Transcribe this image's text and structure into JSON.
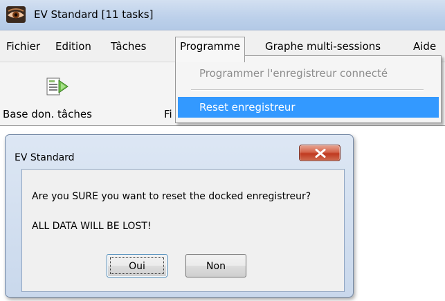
{
  "main_window": {
    "title": "EV Standard [11 tasks]",
    "icon": "eye-app-icon"
  },
  "menubar": {
    "items": [
      {
        "label": "Fichier"
      },
      {
        "label": "Edition"
      },
      {
        "label": "Tâches"
      },
      {
        "label": "Programme",
        "open": true
      },
      {
        "label": "Graphe multi-sessions"
      },
      {
        "label": "Aide"
      }
    ]
  },
  "toolbar": {
    "items": [
      {
        "label": "Base don. tâches",
        "icon": "task-database-icon"
      },
      {
        "label": "Fi"
      }
    ]
  },
  "programme_menu": {
    "items": [
      {
        "label": "Programmer l'enregistreur connecté",
        "enabled": false
      },
      {
        "label": "Reset enregistreur",
        "enabled": true,
        "highlighted": true
      }
    ]
  },
  "dialog": {
    "title": "EV Standard",
    "close_icon": "close-icon",
    "message_line1": "Are you SURE you want to reset the docked enregistreur?",
    "message_line2": "ALL DATA WILL BE LOST!",
    "buttons": {
      "yes_label": "Oui",
      "no_label": "Non"
    }
  },
  "colors": {
    "menu_highlight": "#3399ff",
    "title_bar": "#bcd0ea",
    "close_button": "#c9503a",
    "disabled_text": "#8d8d8d"
  }
}
